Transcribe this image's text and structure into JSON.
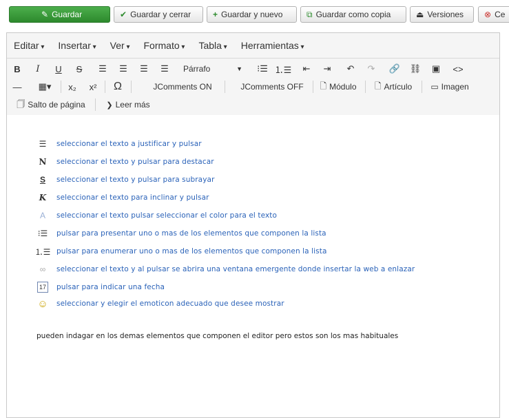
{
  "toolbar": {
    "save": "Guardar",
    "save_close": "Guardar y cerrar",
    "save_new": "Guardar y nuevo",
    "save_copy": "Guardar como copia",
    "versions": "Versiones",
    "cancel": "Ce"
  },
  "menubar": [
    "Editar",
    "Insertar",
    "Ver",
    "Formato",
    "Tabla",
    "Herramientas"
  ],
  "format_select": "Párrafo",
  "buttons": {
    "jcomments_on": "JComments ON",
    "jcomments_off": "JComments OFF",
    "modulo": "Módulo",
    "articulo": "Artículo",
    "imagen": "Imagen",
    "salto": "Salto de página",
    "leer_mas": "Leer más"
  },
  "content": {
    "lines": [
      "seleccionar el texto a justificar y pulsar",
      "seleccionar el texto y pulsar para destacar",
      "seleccionar el texto y pulsar para subrayar",
      "seleccionar el texto para inclinar y pulsar",
      "seleccionar el texto pulsar seleccionar el color para el texto",
      "pulsar para presentar uno o mas de los elementos que componen la lista",
      "pulsar para enumerar uno o mas de los elementos que componen la lista",
      "seleccionar el texto y al pulsar se abrira una ventana emergente donde insertar la web a enlazar",
      "pulsar para indicar una fecha",
      "seleccionar y elegir el emoticon adecuado que desee mostrar"
    ],
    "footer": "pueden indagar en los demas elementos que componen el editor pero estos son los mas habituales"
  }
}
